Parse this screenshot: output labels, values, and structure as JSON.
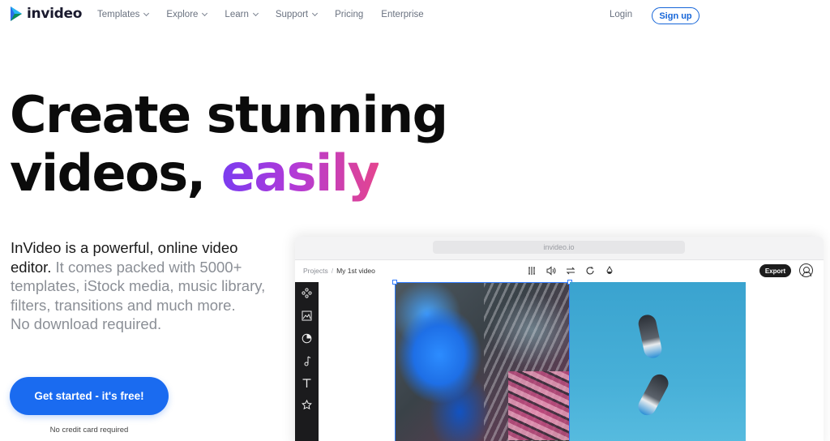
{
  "nav": {
    "logo_text": "invideo",
    "links": [
      {
        "label": "Templates",
        "dropdown": true
      },
      {
        "label": "Explore",
        "dropdown": true
      },
      {
        "label": "Learn",
        "dropdown": true
      },
      {
        "label": "Support",
        "dropdown": true
      },
      {
        "label": "Pricing",
        "dropdown": false
      },
      {
        "label": "Enterprise",
        "dropdown": false
      }
    ],
    "login": "Login",
    "signup": "Sign up"
  },
  "hero": {
    "headline_line1": "Create stunning",
    "headline_line2_plain": "videos,",
    "headline_line2_accent": "easily",
    "desc_strong_1": "InVideo is a powerful, online video",
    "desc_strong_2": "editor.",
    "desc_rest": "It comes packed with 5000+ templates, iStock media, music library, filters, transitions and much more.",
    "desc_end": "No download required.",
    "cta": "Get started - it's free!",
    "cta_note": "No credit card required"
  },
  "editor": {
    "url": "invideo.io",
    "breadcrumb_root": "Projects",
    "breadcrumb_sep": "/",
    "breadcrumb_current": "My 1st video",
    "export": "Export",
    "toolbar_icons": [
      "split-icon",
      "volume-icon",
      "swap-icon",
      "rotate-icon",
      "opacity-icon"
    ],
    "sidebar_icons": [
      "layout-icon",
      "image-icon",
      "sticker-icon",
      "music-icon",
      "text-icon",
      "star-icon"
    ]
  },
  "colors": {
    "brand_blue": "#1a6bf0",
    "accent_gradient": [
      "#7a3cf0",
      "#e4458f"
    ],
    "text_muted": "#8b8f96"
  }
}
